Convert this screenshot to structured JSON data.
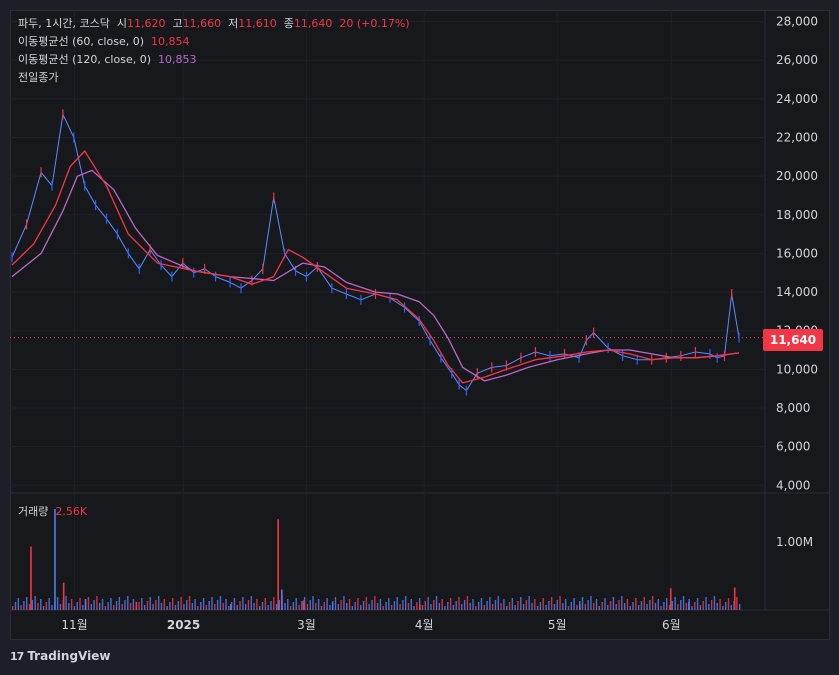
{
  "header": {
    "symbol": "파두, 1시간, 코스닥",
    "open_label": "시",
    "open": "11,620",
    "high_label": "고",
    "high": "11,660",
    "low_label": "저",
    "low": "11,610",
    "close_label": "종",
    "close": "11,640",
    "change": "20 (+0.17%)"
  },
  "indicators": [
    {
      "label": "이동평균선 (60, close, 0)",
      "value": "10,854",
      "color": "#f23645"
    },
    {
      "label": "이동평균선 (120, close, 0)",
      "value": "10,853",
      "color": "#ba68c8"
    },
    {
      "label": "전일종가",
      "value": ""
    }
  ],
  "volume": {
    "label": "거래량",
    "value": "2.56K"
  },
  "last_price_label": "11,640",
  "brand": {
    "name": "TradingView"
  },
  "colors": {
    "up": "#f23645",
    "down": "#2962ff",
    "ma60": "#f23645",
    "ma120": "#ba68c8",
    "grid": "#2a2d36",
    "axis_text": "#d1d4dc",
    "background": "#17181c"
  },
  "chart_data": {
    "type": "line",
    "title": "",
    "price_axis": {
      "ticks": [
        "28,000",
        "26,000",
        "24,000",
        "22,000",
        "20,000",
        "18,000",
        "16,000",
        "14,000",
        "12,000",
        "10,000",
        "8,000",
        "6,000",
        "4,000"
      ],
      "tick_values": [
        28000,
        26000,
        24000,
        22000,
        20000,
        18000,
        16000,
        14000,
        12000,
        10000,
        8000,
        6000,
        4000
      ],
      "ylim": [
        3600,
        28600
      ]
    },
    "volume_axis": {
      "ticks": [
        "1.00M"
      ],
      "tick_values": [
        1000000
      ],
      "ylim": [
        0,
        1700000
      ]
    },
    "time_axis": {
      "labels": [
        "11월",
        "2025",
        "3월",
        "4월",
        "5월",
        "6월"
      ],
      "positions": [
        0.086,
        0.236,
        0.405,
        0.567,
        0.75,
        0.907
      ]
    },
    "last_close": 11640,
    "series": [
      {
        "name": "파두",
        "x": [
          0,
          0.02,
          0.04,
          0.055,
          0.07,
          0.085,
          0.1,
          0.115,
          0.13,
          0.145,
          0.16,
          0.175,
          0.19,
          0.205,
          0.22,
          0.235,
          0.25,
          0.265,
          0.28,
          0.3,
          0.315,
          0.33,
          0.345,
          0.36,
          0.375,
          0.39,
          0.405,
          0.42,
          0.44,
          0.46,
          0.48,
          0.5,
          0.52,
          0.54,
          0.56,
          0.575,
          0.59,
          0.605,
          0.615,
          0.625,
          0.64,
          0.66,
          0.68,
          0.7,
          0.72,
          0.74,
          0.76,
          0.78,
          0.79,
          0.8,
          0.82,
          0.84,
          0.86,
          0.88,
          0.9,
          0.92,
          0.94,
          0.96,
          0.97,
          0.98,
          0.99,
          1.0
        ],
        "values": [
          15800,
          17500,
          20200,
          19500,
          23200,
          22000,
          19500,
          18500,
          17800,
          17000,
          16000,
          15200,
          16200,
          15400,
          14800,
          15500,
          15000,
          15200,
          14800,
          14500,
          14200,
          14600,
          15200,
          18900,
          16000,
          15100,
          14800,
          15300,
          14200,
          13900,
          13600,
          13900,
          13700,
          13200,
          12500,
          11500,
          10600,
          9800,
          9200,
          8900,
          9800,
          10100,
          10200,
          10600,
          10900,
          10700,
          10800,
          10600,
          11500,
          11900,
          11100,
          10700,
          10500,
          10500,
          10600,
          10700,
          10900,
          10800,
          10600,
          10700,
          13900,
          11640
        ]
      },
      {
        "name": "이동평균선 (60, close, 0)",
        "x": [
          0,
          0.03,
          0.06,
          0.08,
          0.1,
          0.13,
          0.16,
          0.2,
          0.25,
          0.3,
          0.33,
          0.36,
          0.38,
          0.4,
          0.43,
          0.46,
          0.5,
          0.53,
          0.56,
          0.58,
          0.6,
          0.62,
          0.65,
          0.68,
          0.72,
          0.76,
          0.79,
          0.82,
          0.85,
          0.88,
          0.91,
          0.94,
          0.97,
          1.0
        ],
        "values": [
          15400,
          16500,
          18500,
          20500,
          21300,
          19500,
          17000,
          15500,
          15100,
          14800,
          14400,
          14800,
          16200,
          15800,
          15000,
          14200,
          13900,
          13600,
          12600,
          11500,
          10200,
          9300,
          9600,
          10000,
          10500,
          10700,
          10900,
          11000,
          10800,
          10500,
          10600,
          10600,
          10700,
          10854
        ]
      },
      {
        "name": "이동평균선 (120, close, 0)",
        "x": [
          0,
          0.04,
          0.07,
          0.09,
          0.11,
          0.14,
          0.17,
          0.2,
          0.25,
          0.3,
          0.33,
          0.36,
          0.4,
          0.43,
          0.46,
          0.5,
          0.53,
          0.56,
          0.58,
          0.6,
          0.62,
          0.65,
          0.68,
          0.71,
          0.75,
          0.79,
          0.82,
          0.85,
          0.88,
          0.91,
          0.94,
          0.97,
          1.0
        ],
        "values": [
          14800,
          16000,
          18200,
          20000,
          20300,
          19300,
          17300,
          15900,
          15100,
          14800,
          14700,
          14600,
          15500,
          15300,
          14500,
          14000,
          13900,
          13500,
          12800,
          11600,
          10100,
          9400,
          9700,
          10100,
          10500,
          10800,
          11000,
          11000,
          10800,
          10600,
          10600,
          10700,
          10853
        ]
      }
    ],
    "volume_bars": [
      {
        "x": 0.025,
        "value": 930000
      },
      {
        "x": 0.058,
        "value": 1480000
      },
      {
        "x": 0.07,
        "value": 400000
      },
      {
        "x": 0.1,
        "value": 160000
      },
      {
        "x": 0.17,
        "value": 120000
      },
      {
        "x": 0.3,
        "value": 90000
      },
      {
        "x": 0.365,
        "value": 1330000
      },
      {
        "x": 0.37,
        "value": 300000
      },
      {
        "x": 0.4,
        "value": 140000
      },
      {
        "x": 0.44,
        "value": 110000
      },
      {
        "x": 0.56,
        "value": 80000
      },
      {
        "x": 0.78,
        "value": 90000
      },
      {
        "x": 0.905,
        "value": 320000
      },
      {
        "x": 0.93,
        "value": 120000
      },
      {
        "x": 0.993,
        "value": 330000
      }
    ]
  }
}
